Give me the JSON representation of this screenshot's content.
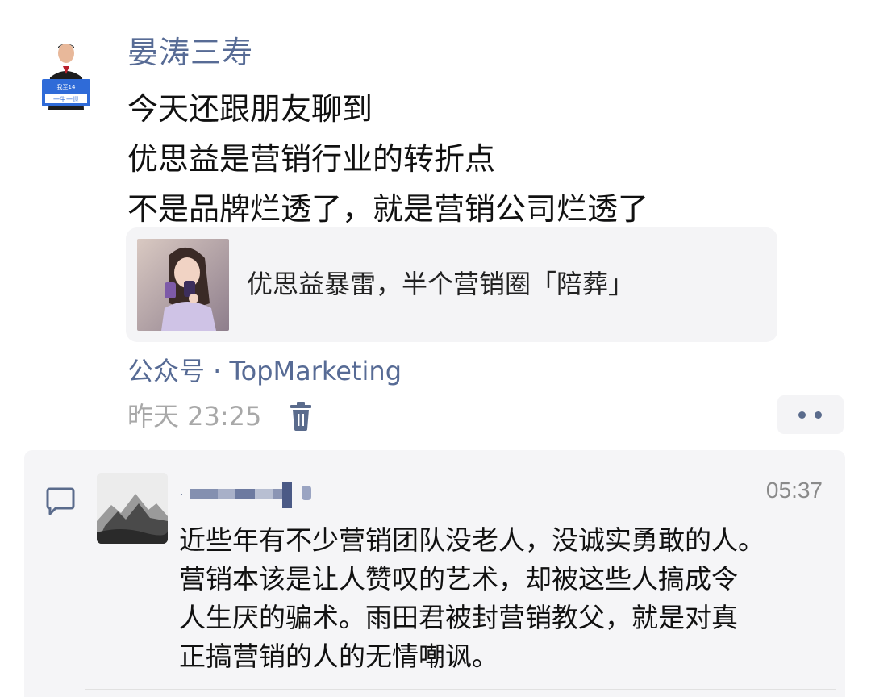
{
  "post": {
    "author": "晏涛三寿",
    "avatar_icon": "person-holding-sign-avatar",
    "avatar_sign_small": "我至14",
    "avatar_sign_big": "一生一世",
    "lines": [
      "今天还跟朋友聊到",
      "优思益是营销行业的转折点",
      "不是品牌烂透了，就是营销公司烂透了"
    ],
    "link": {
      "thumb_icon": "woman-holding-products-thumbnail",
      "title": "优思益暴雷，半个营销圈「陪葬」"
    },
    "source": "公众号 · TopMarketing",
    "time": "昨天 23:25",
    "delete_icon": "trash-icon",
    "more_icon": "more-dots-icon"
  },
  "comment": {
    "icon": "comment-bubble-icon",
    "avatar_icon": "ink-mountain-avatar",
    "name_icon": "blurred-username",
    "time": "05:37",
    "lines": [
      "近些年有不少营销团队没老人，没诚实勇敢的人。",
      "营销本该是让人赞叹的艺术，却被这些人搞成令",
      "人生厌的骗术。雨田君被封营销教父，就是对真",
      "正搞营销的人的无情嘲讽。"
    ]
  },
  "colors": {
    "link_blue": "#576b95",
    "timestamp_gray": "#a8a8a8",
    "panel_bg": "#f5f5f7"
  }
}
